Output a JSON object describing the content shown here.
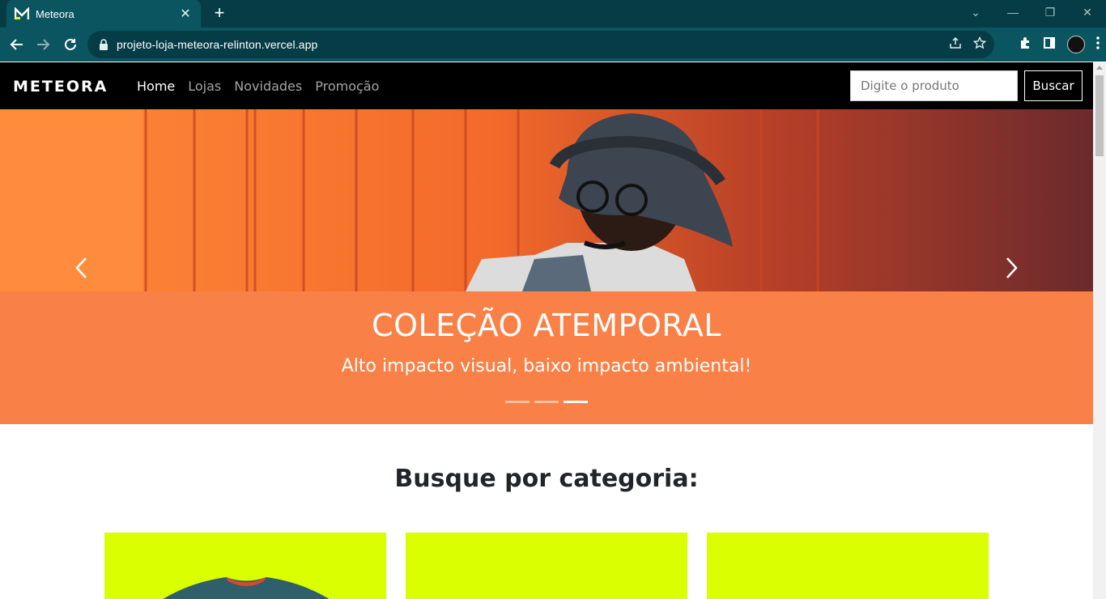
{
  "browser": {
    "tab_title": "Meteora",
    "url": "projeto-loja-meteora-relinton.vercel.app"
  },
  "nav": {
    "logo": "METEORA",
    "links": [
      "Home",
      "Lojas",
      "Novidades",
      "Promoção"
    ],
    "active": "Home",
    "search_placeholder": "Digite o produto",
    "search_button": "Buscar"
  },
  "carousel": {
    "title": "COLEÇÃO ATEMPORAL",
    "subtitle": "Alto impacto visual, baixo impacto ambiental!",
    "slides": 3,
    "active_slide": 3
  },
  "categories": {
    "heading": "Busque por categoria:"
  },
  "colors": {
    "accent": "#f98046",
    "card": "#d9ff00",
    "navbar": "#000000",
    "chrome": "#0b5560"
  },
  "icons": [
    "back-icon",
    "forward-icon",
    "reload-icon",
    "lock-icon",
    "share-icon",
    "star-icon",
    "extensions-icon",
    "sidepanel-icon",
    "menu-icon",
    "prev-arrow-icon",
    "next-arrow-icon"
  ]
}
